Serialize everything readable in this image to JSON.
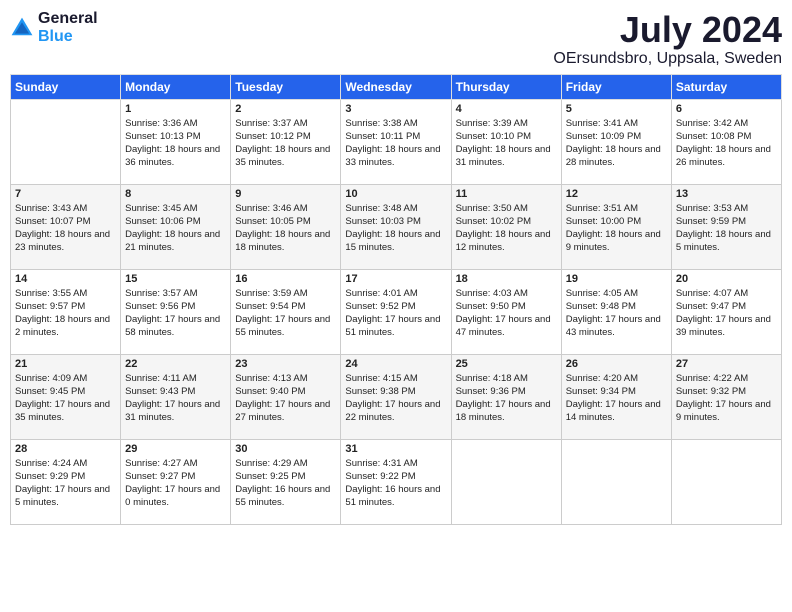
{
  "logo": {
    "general": "General",
    "blue": "Blue"
  },
  "header": {
    "month": "July 2024",
    "location": "OErsundsbro, Uppsala, Sweden"
  },
  "weekdays": [
    "Sunday",
    "Monday",
    "Tuesday",
    "Wednesday",
    "Thursday",
    "Friday",
    "Saturday"
  ],
  "weeks": [
    [
      {
        "day": "",
        "sunrise": "",
        "sunset": "",
        "daylight": ""
      },
      {
        "day": "1",
        "sunrise": "Sunrise: 3:36 AM",
        "sunset": "Sunset: 10:13 PM",
        "daylight": "Daylight: 18 hours and 36 minutes."
      },
      {
        "day": "2",
        "sunrise": "Sunrise: 3:37 AM",
        "sunset": "Sunset: 10:12 PM",
        "daylight": "Daylight: 18 hours and 35 minutes."
      },
      {
        "day": "3",
        "sunrise": "Sunrise: 3:38 AM",
        "sunset": "Sunset: 10:11 PM",
        "daylight": "Daylight: 18 hours and 33 minutes."
      },
      {
        "day": "4",
        "sunrise": "Sunrise: 3:39 AM",
        "sunset": "Sunset: 10:10 PM",
        "daylight": "Daylight: 18 hours and 31 minutes."
      },
      {
        "day": "5",
        "sunrise": "Sunrise: 3:41 AM",
        "sunset": "Sunset: 10:09 PM",
        "daylight": "Daylight: 18 hours and 28 minutes."
      },
      {
        "day": "6",
        "sunrise": "Sunrise: 3:42 AM",
        "sunset": "Sunset: 10:08 PM",
        "daylight": "Daylight: 18 hours and 26 minutes."
      }
    ],
    [
      {
        "day": "7",
        "sunrise": "Sunrise: 3:43 AM",
        "sunset": "Sunset: 10:07 PM",
        "daylight": "Daylight: 18 hours and 23 minutes."
      },
      {
        "day": "8",
        "sunrise": "Sunrise: 3:45 AM",
        "sunset": "Sunset: 10:06 PM",
        "daylight": "Daylight: 18 hours and 21 minutes."
      },
      {
        "day": "9",
        "sunrise": "Sunrise: 3:46 AM",
        "sunset": "Sunset: 10:05 PM",
        "daylight": "Daylight: 18 hours and 18 minutes."
      },
      {
        "day": "10",
        "sunrise": "Sunrise: 3:48 AM",
        "sunset": "Sunset: 10:03 PM",
        "daylight": "Daylight: 18 hours and 15 minutes."
      },
      {
        "day": "11",
        "sunrise": "Sunrise: 3:50 AM",
        "sunset": "Sunset: 10:02 PM",
        "daylight": "Daylight: 18 hours and 12 minutes."
      },
      {
        "day": "12",
        "sunrise": "Sunrise: 3:51 AM",
        "sunset": "Sunset: 10:00 PM",
        "daylight": "Daylight: 18 hours and 9 minutes."
      },
      {
        "day": "13",
        "sunrise": "Sunrise: 3:53 AM",
        "sunset": "Sunset: 9:59 PM",
        "daylight": "Daylight: 18 hours and 5 minutes."
      }
    ],
    [
      {
        "day": "14",
        "sunrise": "Sunrise: 3:55 AM",
        "sunset": "Sunset: 9:57 PM",
        "daylight": "Daylight: 18 hours and 2 minutes."
      },
      {
        "day": "15",
        "sunrise": "Sunrise: 3:57 AM",
        "sunset": "Sunset: 9:56 PM",
        "daylight": "Daylight: 17 hours and 58 minutes."
      },
      {
        "day": "16",
        "sunrise": "Sunrise: 3:59 AM",
        "sunset": "Sunset: 9:54 PM",
        "daylight": "Daylight: 17 hours and 55 minutes."
      },
      {
        "day": "17",
        "sunrise": "Sunrise: 4:01 AM",
        "sunset": "Sunset: 9:52 PM",
        "daylight": "Daylight: 17 hours and 51 minutes."
      },
      {
        "day": "18",
        "sunrise": "Sunrise: 4:03 AM",
        "sunset": "Sunset: 9:50 PM",
        "daylight": "Daylight: 17 hours and 47 minutes."
      },
      {
        "day": "19",
        "sunrise": "Sunrise: 4:05 AM",
        "sunset": "Sunset: 9:48 PM",
        "daylight": "Daylight: 17 hours and 43 minutes."
      },
      {
        "day": "20",
        "sunrise": "Sunrise: 4:07 AM",
        "sunset": "Sunset: 9:47 PM",
        "daylight": "Daylight: 17 hours and 39 minutes."
      }
    ],
    [
      {
        "day": "21",
        "sunrise": "Sunrise: 4:09 AM",
        "sunset": "Sunset: 9:45 PM",
        "daylight": "Daylight: 17 hours and 35 minutes."
      },
      {
        "day": "22",
        "sunrise": "Sunrise: 4:11 AM",
        "sunset": "Sunset: 9:43 PM",
        "daylight": "Daylight: 17 hours and 31 minutes."
      },
      {
        "day": "23",
        "sunrise": "Sunrise: 4:13 AM",
        "sunset": "Sunset: 9:40 PM",
        "daylight": "Daylight: 17 hours and 27 minutes."
      },
      {
        "day": "24",
        "sunrise": "Sunrise: 4:15 AM",
        "sunset": "Sunset: 9:38 PM",
        "daylight": "Daylight: 17 hours and 22 minutes."
      },
      {
        "day": "25",
        "sunrise": "Sunrise: 4:18 AM",
        "sunset": "Sunset: 9:36 PM",
        "daylight": "Daylight: 17 hours and 18 minutes."
      },
      {
        "day": "26",
        "sunrise": "Sunrise: 4:20 AM",
        "sunset": "Sunset: 9:34 PM",
        "daylight": "Daylight: 17 hours and 14 minutes."
      },
      {
        "day": "27",
        "sunrise": "Sunrise: 4:22 AM",
        "sunset": "Sunset: 9:32 PM",
        "daylight": "Daylight: 17 hours and 9 minutes."
      }
    ],
    [
      {
        "day": "28",
        "sunrise": "Sunrise: 4:24 AM",
        "sunset": "Sunset: 9:29 PM",
        "daylight": "Daylight: 17 hours and 5 minutes."
      },
      {
        "day": "29",
        "sunrise": "Sunrise: 4:27 AM",
        "sunset": "Sunset: 9:27 PM",
        "daylight": "Daylight: 17 hours and 0 minutes."
      },
      {
        "day": "30",
        "sunrise": "Sunrise: 4:29 AM",
        "sunset": "Sunset: 9:25 PM",
        "daylight": "Daylight: 16 hours and 55 minutes."
      },
      {
        "day": "31",
        "sunrise": "Sunrise: 4:31 AM",
        "sunset": "Sunset: 9:22 PM",
        "daylight": "Daylight: 16 hours and 51 minutes."
      },
      {
        "day": "",
        "sunrise": "",
        "sunset": "",
        "daylight": ""
      },
      {
        "day": "",
        "sunrise": "",
        "sunset": "",
        "daylight": ""
      },
      {
        "day": "",
        "sunrise": "",
        "sunset": "",
        "daylight": ""
      }
    ]
  ]
}
